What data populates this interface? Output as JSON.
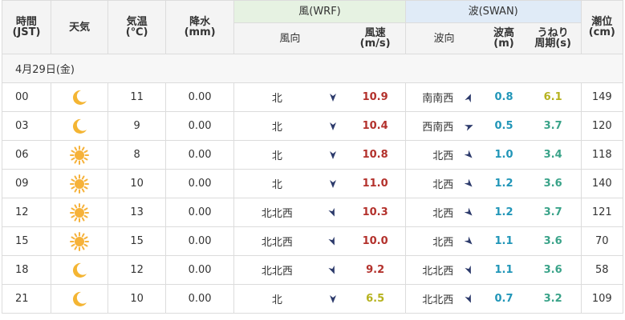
{
  "header": {
    "time": "時間\n(JST)",
    "weather": "天気",
    "temp": "気温\n(℃)",
    "precip": "降水\n(mm)",
    "wind_group": "風(WRF)",
    "wind_dir": "風向",
    "wind_speed": "風速\n(m/s)",
    "wave_group": "波(SWAN)",
    "wave_dir": "波向",
    "wave_height": "波高\n(m)",
    "swell_period": "うねり\n周期(s)",
    "tide": "潮位\n(cm)"
  },
  "date_label": "4月29日(金)",
  "colors": {
    "accent_red": "#b3312c",
    "wave_blue": "#2196b8",
    "period_green": "#3aa389",
    "period_yellow": "#b6b21e",
    "wind_yellow": "#b6b21e",
    "arrow": "#2c3a6b"
  },
  "rows": [
    {
      "time": "00",
      "icon": "moon-icon",
      "temp": "11",
      "precip": "0.00",
      "wind_dir": "北",
      "wind_dir_deg": 0,
      "wind_speed": "10.9",
      "wave_dir": "南南西",
      "wave_dir_deg": 202.5,
      "wave_height": "0.8",
      "period": "6.1",
      "tide": "149"
    },
    {
      "time": "03",
      "icon": "moon-icon",
      "temp": "9",
      "precip": "0.00",
      "wind_dir": "北",
      "wind_dir_deg": 0,
      "wind_speed": "10.4",
      "wave_dir": "西南西",
      "wave_dir_deg": 247.5,
      "wave_height": "0.5",
      "period": "3.7",
      "tide": "120"
    },
    {
      "time": "06",
      "icon": "sun-icon",
      "temp": "8",
      "precip": "0.00",
      "wind_dir": "北",
      "wind_dir_deg": 0,
      "wind_speed": "10.8",
      "wave_dir": "北西",
      "wave_dir_deg": 315,
      "wave_height": "1.0",
      "period": "3.4",
      "tide": "118"
    },
    {
      "time": "09",
      "icon": "sun-icon",
      "temp": "10",
      "precip": "0.00",
      "wind_dir": "北",
      "wind_dir_deg": 0,
      "wind_speed": "11.0",
      "wave_dir": "北西",
      "wave_dir_deg": 315,
      "wave_height": "1.2",
      "period": "3.6",
      "tide": "140"
    },
    {
      "time": "12",
      "icon": "sun-icon",
      "temp": "13",
      "precip": "0.00",
      "wind_dir": "北北西",
      "wind_dir_deg": 337.5,
      "wind_speed": "10.3",
      "wave_dir": "北西",
      "wave_dir_deg": 315,
      "wave_height": "1.2",
      "period": "3.7",
      "tide": "121"
    },
    {
      "time": "15",
      "icon": "sun-icon",
      "temp": "15",
      "precip": "0.00",
      "wind_dir": "北北西",
      "wind_dir_deg": 337.5,
      "wind_speed": "10.0",
      "wave_dir": "北西",
      "wave_dir_deg": 315,
      "wave_height": "1.1",
      "period": "3.6",
      "tide": "70"
    },
    {
      "time": "18",
      "icon": "moon-icon",
      "temp": "12",
      "precip": "0.00",
      "wind_dir": "北北西",
      "wind_dir_deg": 337.5,
      "wind_speed": "9.2",
      "wave_dir": "北北西",
      "wave_dir_deg": 337.5,
      "wave_height": "1.1",
      "period": "3.6",
      "tide": "58"
    },
    {
      "time": "21",
      "icon": "moon-icon",
      "temp": "10",
      "precip": "0.00",
      "wind_dir": "北",
      "wind_dir_deg": 0,
      "wind_speed": "6.5",
      "wave_dir": "北北西",
      "wave_dir_deg": 337.5,
      "wave_height": "0.7",
      "period": "3.2",
      "tide": "109"
    }
  ]
}
